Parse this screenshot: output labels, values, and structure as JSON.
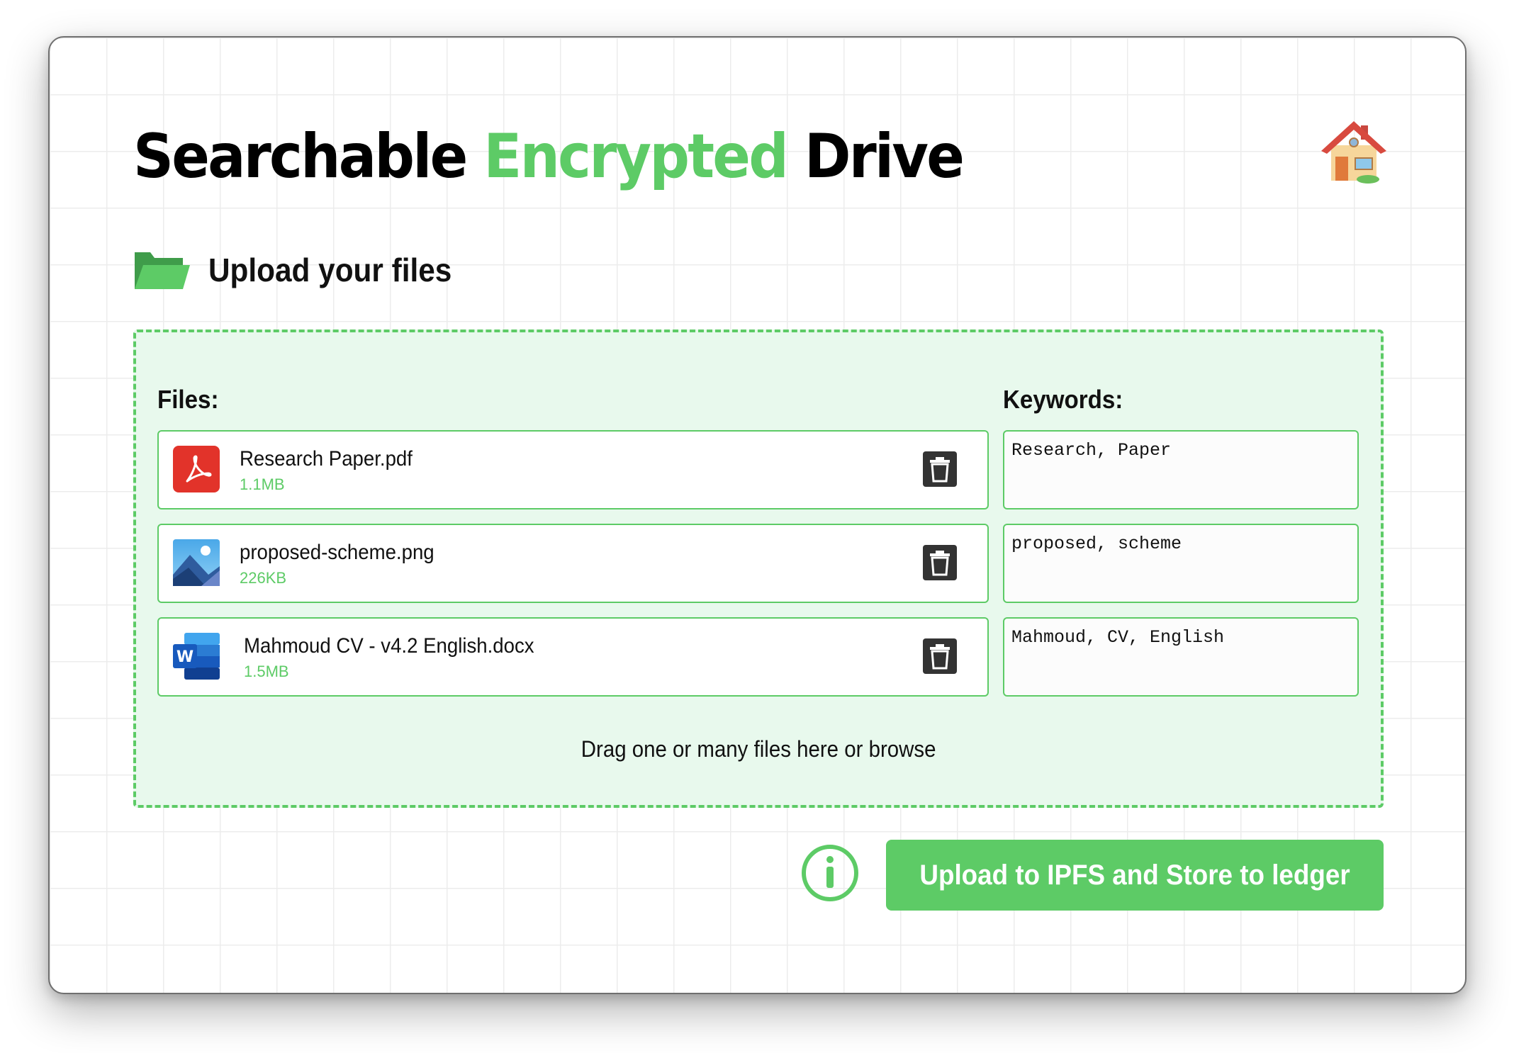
{
  "header": {
    "title_part1": "Searchable ",
    "title_part2": "Encrypted",
    "title_part3": " Drive",
    "home_icon": "house-icon"
  },
  "upload_section": {
    "heading": "Upload your files",
    "heading_icon": "open-folder-icon",
    "files_label": "Files:",
    "keywords_label": "Keywords:",
    "drag_text": "Drag one or many files here or browse"
  },
  "files": [
    {
      "name": "Research Paper.pdf",
      "size": "1.1MB",
      "icon": "pdf-icon",
      "keywords": "Research, Paper"
    },
    {
      "name": "proposed-scheme.png",
      "size": "226KB",
      "icon": "image-icon",
      "keywords": "proposed, scheme"
    },
    {
      "name": "Mahmoud CV - v4.2 English.docx",
      "size": "1.5MB",
      "icon": "word-icon",
      "keywords": "Mahmoud, CV, English"
    }
  ],
  "actions": {
    "info_icon": "info-icon",
    "upload_label": "Upload to IPFS and Store to ledger"
  },
  "colors": {
    "accent": "#5dcb66",
    "dropzone_bg": "#e8f9ed",
    "pdf_red": "#e2332a",
    "word_blue": "#2b579a"
  }
}
